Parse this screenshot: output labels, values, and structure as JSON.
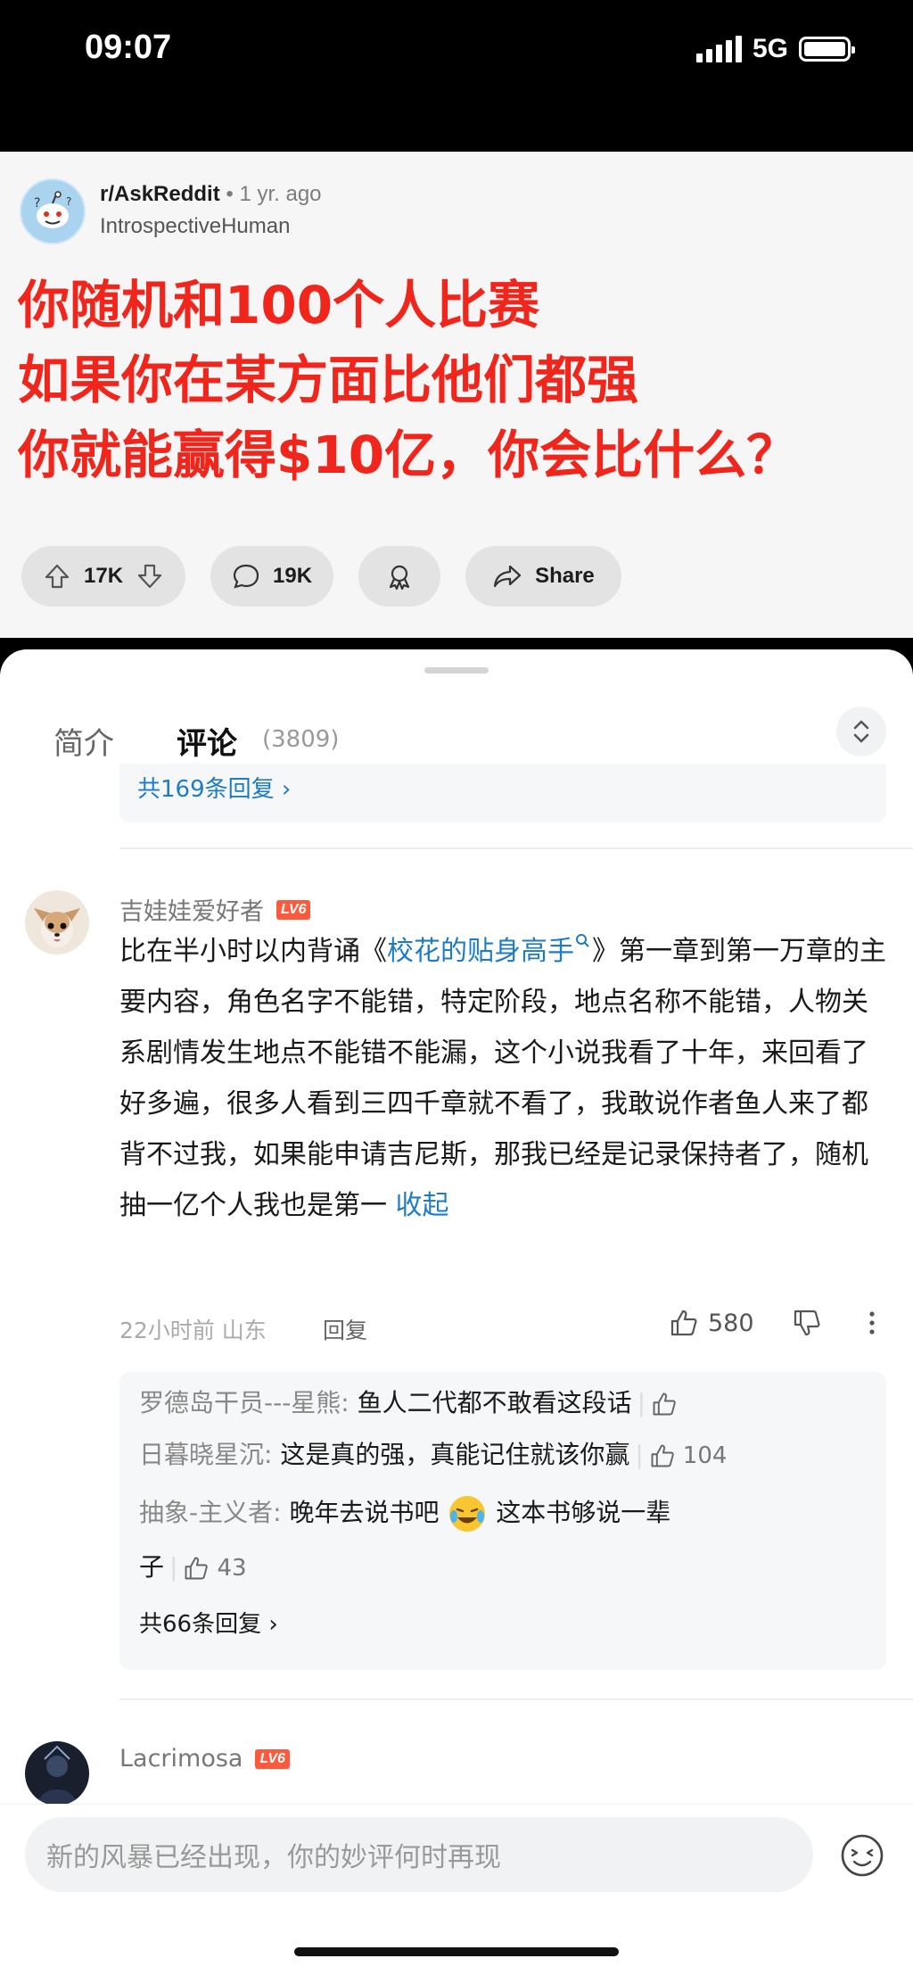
{
  "status": {
    "time": "09:07",
    "network": "5G"
  },
  "post": {
    "subreddit": "r/AskReddit",
    "age": "1 yr. ago",
    "author": "IntrospectiveHuman",
    "title_lines": [
      "你随机和100个人比赛",
      "如果你在某方面比他们都强",
      "你就能赢得$10亿，你会比什么？"
    ],
    "upvotes": "17K",
    "comments": "19K",
    "share_label": "Share",
    "title_color": "#f0261c"
  },
  "tabs": {
    "intro": "简介",
    "comments": "评论",
    "count": "(3809)"
  },
  "prev_thread": {
    "more_replies": "共169条回复 ›"
  },
  "comment": {
    "username": "吉娃娃爱好者",
    "level": "LV6",
    "body_prefix": "比在半小时以内背诵《",
    "body_link": "校花的贴身高手",
    "body_main": "》第一章到第一万章的主要内容，角色名字不能错，特定阶段，地点名称不能错，人物关系剧情发生地点不能错不能漏，这个小说我看了十年，来回看了好多遍，很多人看到三四千章就不看了，我敢说作者鱼人来了都背不过我，如果能申请吉尼斯，那我已经是记录保持者了，随机抽一亿个人我也是第一",
    "collapse": "收起",
    "time_loc": "22小时前 山东",
    "reply_label": "回复",
    "likes": "580",
    "replies": [
      {
        "user": "罗德岛干员---星熊:",
        "text": " 鱼人二代都不敢看这段话",
        "likes": ""
      },
      {
        "user": "日暮晓星沉:",
        "text": " 这是真的强，真能记住就该你赢",
        "likes": "104"
      },
      {
        "user": "抽象-主义者:",
        "text": " 晚年去说书吧",
        "text2": " 这本书够说一辈",
        "text3": "子",
        "likes": "43"
      }
    ],
    "more_replies": "共66条回复 ›"
  },
  "next_comment": {
    "username": "Lacrimosa",
    "level": "LV6"
  },
  "input": {
    "placeholder": "新的风暴已经出现，你的妙评何时再现"
  }
}
